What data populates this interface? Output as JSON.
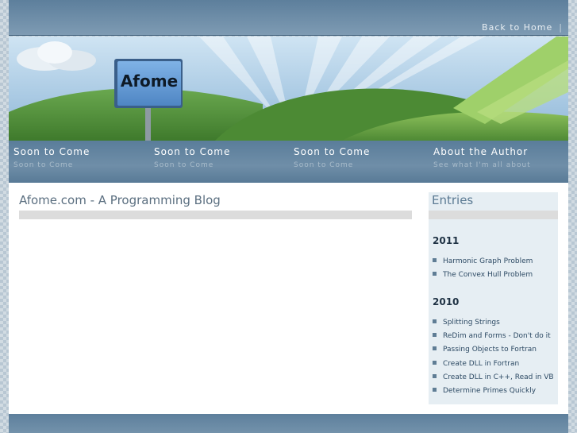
{
  "header": {
    "back_home_label": "Back to Home",
    "separator": "|"
  },
  "banner": {
    "sign_text": "Afome"
  },
  "nav": {
    "items": [
      {
        "title": "Soon to Come",
        "subtitle": "Soon to Come"
      },
      {
        "title": "Soon to Come",
        "subtitle": "Soon to Come"
      },
      {
        "title": "Soon to Come",
        "subtitle": "Soon to Come"
      },
      {
        "title": "About the Author",
        "subtitle": "See what I'm all about"
      }
    ]
  },
  "main": {
    "title": "Afome.com - A Programming Blog"
  },
  "sidebar": {
    "title": "Entries",
    "groups": [
      {
        "year": "2011",
        "entries": [
          "Harmonic Graph Problem",
          "The Convex Hull Problem"
        ]
      },
      {
        "year": "2010",
        "entries": [
          "Splitting Strings",
          "ReDim and Forms - Don't do it",
          "Passing Objects to Fortran",
          "Create DLL in Fortran",
          "Create DLL in C++, Read in VB",
          "Determine Primes Quickly"
        ]
      }
    ]
  },
  "colors": {
    "nav_bar": "#6f8ea8",
    "title_text": "#5b6f80",
    "sidebar_bg": "#e6eef3",
    "hill_green": "#6aa84f",
    "sky_blue": "#9cc3e0"
  }
}
